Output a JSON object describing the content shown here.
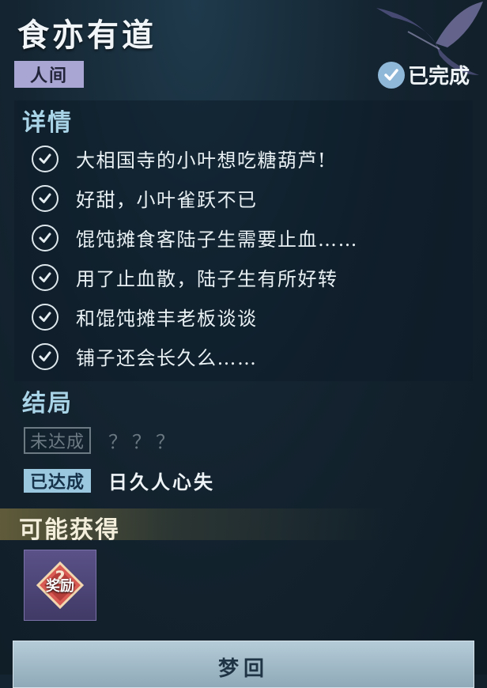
{
  "quest": {
    "title": "食亦有道",
    "world_tag": "人间",
    "status": "已完成"
  },
  "details": {
    "heading": "详情",
    "items": [
      "大相国寺的小叶想吃糖葫芦!",
      "好甜，小叶雀跃不已",
      "馄饨摊食客陆子生需要止血……",
      "用了止血散，陆子生有所好转",
      "和馄饨摊丰老板谈谈",
      "铺子还会长久么……"
    ]
  },
  "endings": {
    "heading": "结局",
    "locked": {
      "badge": "未达成",
      "text": "？？？"
    },
    "achieved": {
      "badge": "已达成",
      "text": "日久人心失"
    }
  },
  "rewards": {
    "heading": "可能获得",
    "item_text": "奖励",
    "item_icon": "question-diamond-icon"
  },
  "actions": {
    "dream_back": "梦回"
  },
  "colors": {
    "accent_blue": "#9bc7df",
    "tag_purple": "#a9a6d3",
    "reward_bg": "#4a4478"
  }
}
